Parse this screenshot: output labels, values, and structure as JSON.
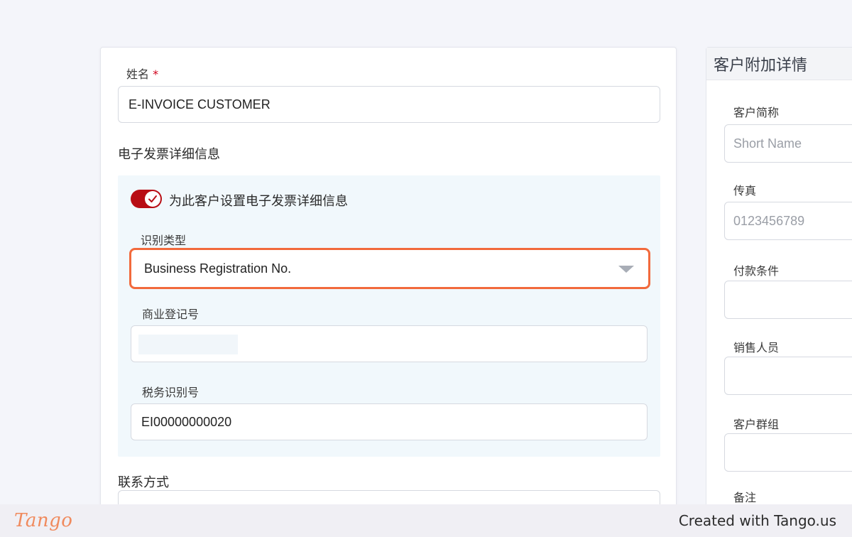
{
  "form": {
    "name_label": "姓名",
    "required_mark": "*",
    "name_value": "E-INVOICE CUSTOMER",
    "einvoice_section_title": "电子发票详细信息",
    "einvoice": {
      "toggle_label": "为此客户设置电子发票详细信息",
      "toggle_on": true,
      "id_type_label": "识别类型",
      "id_type_value": "Business Registration No.",
      "brn_label": "商业登记号",
      "brn_value": "",
      "tin_label": "税务识别号",
      "tin_value": "EI00000000020"
    },
    "contact_section_title": "联系方式"
  },
  "side": {
    "title": "客户附加详情",
    "short_name_label": "客户简称",
    "short_name_placeholder": "Short Name",
    "fax_label": "传真",
    "fax_placeholder": "0123456789",
    "payment_terms_label": "付款条件",
    "salesperson_label": "销售人员",
    "customer_group_label": "客户群组",
    "remarks_label": "备注"
  },
  "footer": {
    "logo": "Tango",
    "created_with": "Created with Tango.us"
  },
  "colors": {
    "toggle": "#b80d14",
    "highlight": "#f26a3c",
    "einvoice_bg": "#f1f8fc"
  }
}
